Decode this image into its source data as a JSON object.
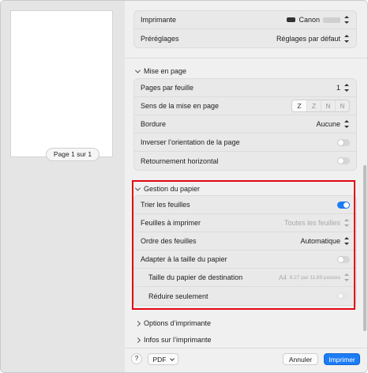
{
  "preview": {
    "page_label": "Page 1 sur 1"
  },
  "header": {
    "printer_label": "Imprimante",
    "printer_value": "Canon",
    "presets_label": "Préréglages",
    "presets_value": "Réglages par défaut"
  },
  "layout": {
    "title": "Mise en page",
    "pages_label": "Pages par feuille",
    "pages_value": "1",
    "direction_label": "Sens de la mise en page",
    "direction_options": [
      "Z",
      "Z",
      "N",
      "N"
    ],
    "border_label": "Bordure",
    "border_value": "Aucune",
    "invert_label": "Inverser l’orientation de la page",
    "flip_label": "Retournement horizontal"
  },
  "paper": {
    "title": "Gestion du papier",
    "collate_label": "Trier les feuilles",
    "collate_on": true,
    "sheets_label": "Feuilles à imprimer",
    "sheets_value": "Toutes les feuilles",
    "order_label": "Ordre des feuilles",
    "order_value": "Automatique",
    "fit_label": "Adapter à la taille du papier",
    "fit_on": false,
    "dest_label": "Taille du papier de destination",
    "dest_size": "A4",
    "dest_dims": "8,27 par 11,69 pouces",
    "reduce_label": "Réduire seulement"
  },
  "collapsed": {
    "options_label": "Options d’imprimante",
    "info_label": "Infos sur l’imprimante"
  },
  "footer": {
    "help": "?",
    "pdf": "PDF",
    "cancel": "Annuler",
    "print": "Imprimer"
  },
  "colors": {
    "accent": "#1b7cf5",
    "highlight": "#e30613"
  }
}
